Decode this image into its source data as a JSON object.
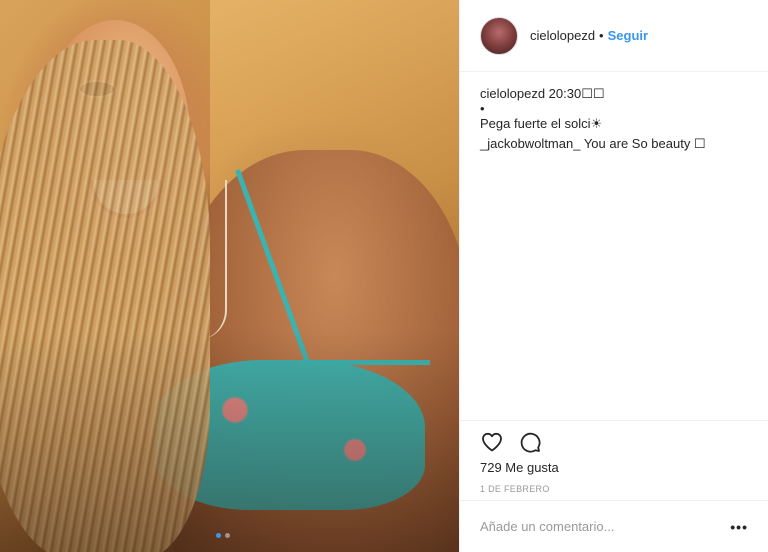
{
  "post": {
    "photo_alt": "",
    "carousel": {
      "count": 2,
      "active_index": 0
    }
  },
  "header": {
    "username": "cielolopezd",
    "separator": "•",
    "follow_label": "Seguir"
  },
  "comments": [
    {
      "username": "cielolopezd",
      "text": " 20:30☐☐"
    },
    {
      "username": "",
      "text": "•"
    },
    {
      "username": "",
      "text": "Pega fuerte el solci☀"
    },
    {
      "username": "_jackobwoltman_",
      "text": " You are So beauty ☐"
    }
  ],
  "actions": {
    "like_icon": "heart-icon",
    "comment_icon": "comment-icon",
    "likes_text": "729 Me gusta",
    "date_text": "1 DE FEBRERO"
  },
  "add_comment": {
    "placeholder": "Añade un comentario...",
    "more_label": "•••"
  },
  "colors": {
    "accent": "#3897f0",
    "text": "#262626",
    "muted": "#999999",
    "border": "#efefef"
  }
}
